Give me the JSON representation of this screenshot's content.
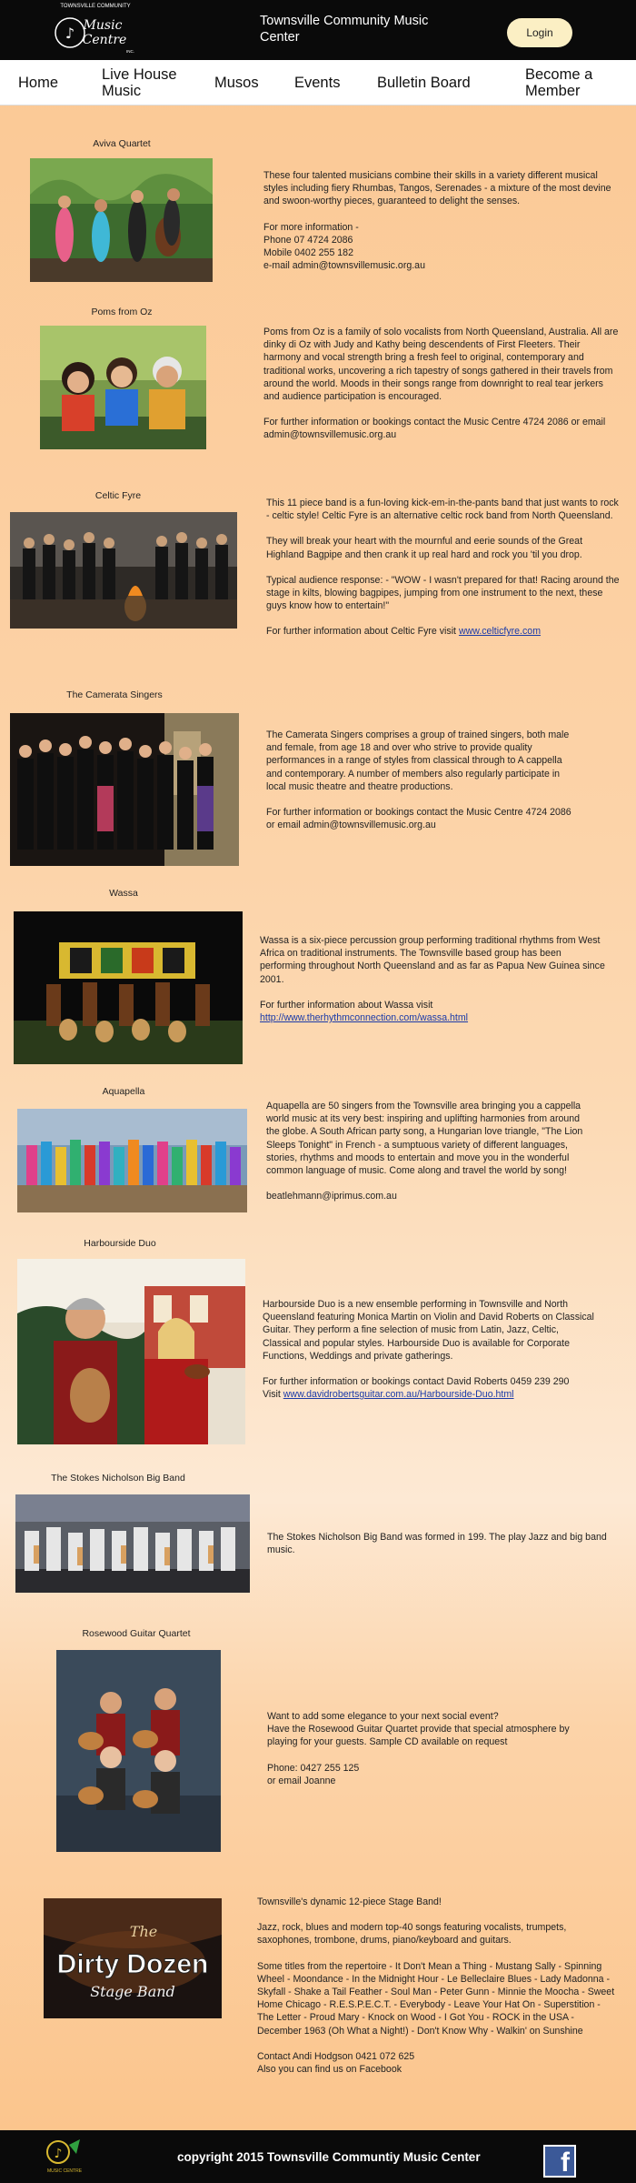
{
  "header": {
    "logo_text": "TOWNSVILLE COMMUNITY Music Centre INC.",
    "site_title": "Townsville Community Music Center",
    "login_label": "Login"
  },
  "nav": [
    {
      "label": "Home"
    },
    {
      "label": "Live House Music"
    },
    {
      "label": "Musos"
    },
    {
      "label": "Events"
    },
    {
      "label": "Bulletin Board"
    },
    {
      "label": "Become a Member"
    }
  ],
  "groups": [
    {
      "name": "Aviva Quartet",
      "paragraphs": [
        "These four talented musicians combine their skills in a variety different musical styles including fiery Rhumbas, Tangos, Serenades - a mixture of the most devine and swoon-worthy pieces, guaranteed to delight the senses.",
        "For more information -\nPhone   07 4724 2086\nMobile    0402 255 182\ne-mail admin@townsvillemusic.org.au"
      ]
    },
    {
      "name": "Poms from Oz",
      "paragraphs": [
        "Poms from Oz is a family of solo vocalists from North Queensland, Australia. All are dinky di Oz with Judy and Kathy being descendents of First Fleeters. Their harmony and vocal strength bring a fresh feel to original, contemporary and traditional works, uncovering a rich tapestry of songs gathered in their travels from around the world. Moods in their songs range from downright to real tear jerkers and audience participation is encouraged.",
        "For further information or bookings contact the Music Centre 4724 2086 or email admin@townsvillemusic.org.au"
      ]
    },
    {
      "name": "Celtic Fyre",
      "paragraphs": [
        "This 11 piece band is a fun-loving kick-em-in-the-pants band that just wants to rock - celtic style! Celtic Fyre is an alternative celtic rock band from North Queensland.",
        "They will break your heart with the mournful and eerie sounds of the Great Highland Bagpipe and then crank it up real hard and rock you 'til you drop.",
        "Typical audience response: - \"WOW - I wasn't prepared for that! Racing around the stage in kilts, blowing bagpipes, jumping from one instrument to the next, these guys know how to entertain!\"",
        "For further information about Celtic Fyre visit "
      ],
      "link": "www.celticfyre.com"
    },
    {
      "name": "The Camerata Singers",
      "paragraphs": [
        "The Camerata Singers comprises a group of trained singers, both male and female, from age 18 and over who strive to provide quality performances in a range of styles from classical through to A cappella and contemporary. A number of members also regularly participate in local music theatre and theatre productions.",
        "For further information or bookings contact the Music Centre 4724 2086 or email admin@townsvillemusic.org.au"
      ]
    },
    {
      "name": "Wassa",
      "paragraphs": [
        "Wassa is a six-piece percussion group performing traditional rhythms from West Africa on traditional instruments. The Townsville based group has been performing throughout North Queensland and as far as Papua New Guinea since 2001.",
        "For further information about Wassa visit"
      ],
      "link": "http://www.therhythmconnection.com/wassa.html"
    },
    {
      "name": "Aquapella",
      "paragraphs": [
        "Aquapella are 50 singers from the Townsville area bringing you a cappella world music at its very best: inspiring and uplifting harmonies from around the globe. A South African party song, a Hungarian love triangle, \"The Lion Sleeps Tonight\" in French - a sumptuous variety of different languages, stories, rhythms and moods to entertain and move you in the wonderful common language of music. Come along and travel the world by song!",
        "beatlehmann@iprimus.com.au"
      ]
    },
    {
      "name": "Harbourside Duo",
      "paragraphs": [
        "Harbourside Duo is a new ensemble performing in Townsville and North Queensland featuring Monica Martin on Violin and David Roberts on Classical Guitar. They perform a fine selection of music from Latin, Jazz, Celtic, Classical and popular styles. Harbourside Duo is available for Corporate Functions, Weddings and private gatherings.",
        "For further information or bookings contact David Roberts 0459 239 290\nVisit "
      ],
      "link": "www.davidrobertsguitar.com.au/Harbourside-Duo.html"
    },
    {
      "name": "The Stokes Nicholson Big Band",
      "paragraphs": [
        "The Stokes Nicholson Big Band was formed in 199.  The play Jazz and big band music."
      ]
    },
    {
      "name": "Rosewood Guitar Quartet",
      "paragraphs": [
        "Want to add some elegance to your next social event?\nHave the Rosewood Guitar Quartet provide that special atmosphere by playing for your guests. Sample CD available on request",
        "Phone: 0427 255 125\nor email Joanne"
      ]
    },
    {
      "name": "The Dirty Dozen Stage Band",
      "logo_title": "The",
      "logo_main": "Dirty Dozen",
      "logo_sub": "Stage Band",
      "paragraphs": [
        "Townsville's dynamic 12-piece Stage Band!",
        "Jazz, rock, blues and modern top-40 songs featuring vocalists, trumpets, saxophones, trombone, drums, piano/keyboard and guitars.",
        "Some titles from the repertoire   -   It Don't Mean a Thing   -   Mustang Sally   -   Spinning Wheel   -   Moondance   -   In the Midnight Hour   -   Le Belleclaire Blues   -   Lady Madonna   -   Skyfall   -   Shake a Tail Feather   -   Soul Man   -   Peter Gunn   -   Minnie the Moocha   -   Sweet Home Chicago   -   R.E.S.P.E.C.T.   -   Everybody   -   Leave Your Hat On   -   Superstition   -   The Letter   -   Proud Mary   -   Knock on Wood   -   I Got You   -   ROCK in the USA   -   December 1963 (Oh What a Night!)   -   Don't Know Why   -   Walkin' on Sunshine",
        "Contact Andi Hodgson 0421 072 625\nAlso you can find us on Facebook"
      ]
    }
  ],
  "footer": {
    "copyright": "copyright 2015 Townsville Communtiy Music Center",
    "facebook_icon": "facebook-icon",
    "footer_logo": "music-centre-logo"
  },
  "colors": {
    "header_bg": "#0a0a0a",
    "login_bg": "#fbefc4",
    "page_bg_top": "#fbc894",
    "page_bg_mid": "#fde9d4",
    "link": "#1a3aa8",
    "facebook": "#3b5998"
  }
}
